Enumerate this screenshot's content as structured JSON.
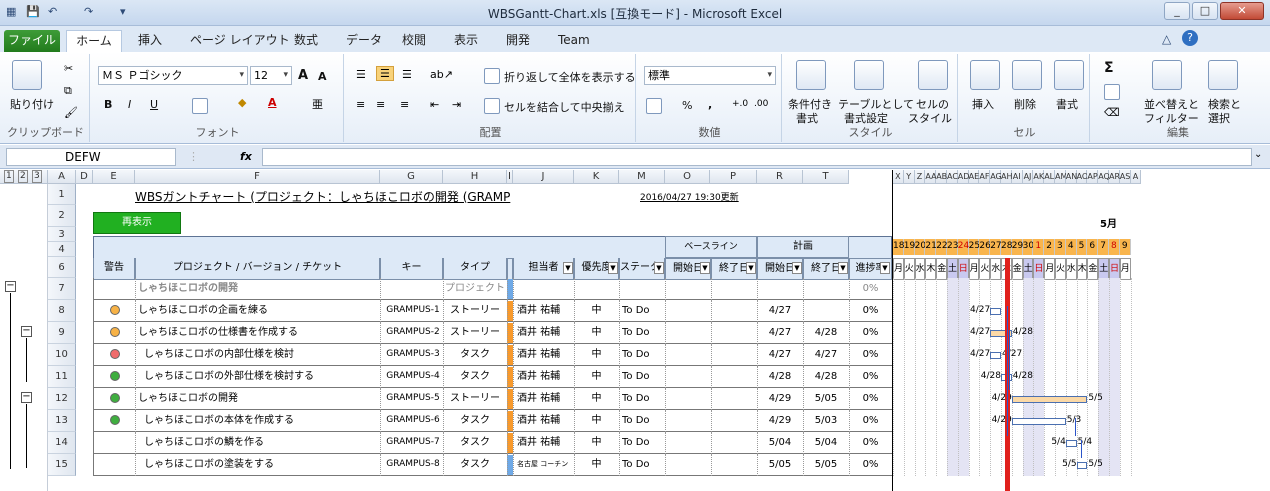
{
  "window": {
    "title": "WBSGantt-Chart.xls [互換モード] - Microsoft Excel",
    "controls": {
      "min": "_",
      "max": "□",
      "close": "✕"
    }
  },
  "tabs": [
    "ファイル",
    "ホーム",
    "挿入",
    "ページ レイアウト",
    "数式",
    "データ",
    "校閲",
    "表示",
    "開発",
    "Team"
  ],
  "ribbon": {
    "clipboard": {
      "paste": "貼り付け",
      "label": "クリップボード"
    },
    "font": {
      "name": "ＭＳ Ｐゴシック",
      "size": "12",
      "label": "フォント",
      "bold": "B",
      "italic": "I",
      "underline": "U",
      "grow": "A",
      "shrink": "A"
    },
    "align": {
      "wrap": "折り返して全体を表示する",
      "merge": "セルを結合して中央揃え",
      "label": "配置"
    },
    "number": {
      "format": "標準",
      "percent": "%",
      "comma": ",",
      "label": "数値"
    },
    "styles": {
      "cond": "条件付き\n書式",
      "table": "テーブルとして\n書式設定",
      "cell": "セルの\nスタイル",
      "label": "スタイル",
      "cond1": "条件付き",
      "cond2": "書式",
      "table1": "テーブルとして",
      "table2": "書式設定",
      "cell1": "セルの",
      "cell2": "スタイル"
    },
    "cells": {
      "insert": "挿入",
      "delete": "削除",
      "format": "書式",
      "label": "セル"
    },
    "edit": {
      "sigma": "Σ",
      "sort1": "並べ替えと",
      "sort2": "フィルター",
      "find1": "検索と",
      "find2": "選択",
      "label": "編集"
    }
  },
  "formula": {
    "name_box": "DEFW",
    "fx": "fx",
    "value": ""
  },
  "outline_levels": [
    "1",
    "2",
    "3"
  ],
  "columns": [
    "A",
    "D",
    "E",
    "F",
    "G",
    "H",
    "I",
    "J",
    "K",
    "M",
    "O",
    "P",
    "R",
    "T",
    "X",
    "Y",
    "Z",
    "AA",
    "AB",
    "AC",
    "AD",
    "AE",
    "AF",
    "AG",
    "AH",
    "AI",
    "AJ",
    "AK",
    "AL",
    "AM",
    "AN",
    "AO",
    "AP",
    "AQ",
    "AR",
    "AS",
    "A"
  ],
  "sheet": {
    "title": "WBSガントチャート (プロジェクト：しゃちほこロボの開発 (GRAMP",
    "updated": "2016/04/27 19:30更新",
    "redisplay": "再表示",
    "month": "5月",
    "headers": {
      "warning": "警告",
      "project": "プロジェクト / バージョン / チケット",
      "key": "キー",
      "type": "タイプ",
      "assignee": "担当者",
      "priority": "優先度",
      "status": "ステータス",
      "baseline": "ベースライン",
      "base_start": "開始日",
      "base_end": "終了日",
      "plan": "計画",
      "plan_start": "開始日",
      "plan_end": "終了日",
      "progress": "進捗率"
    },
    "row_numbers": [
      "1",
      "2",
      "3",
      "4",
      "6",
      "7",
      "8",
      "9",
      "10",
      "11",
      "12",
      "13",
      "14",
      "15"
    ],
    "days": [
      "18",
      "19",
      "20",
      "21",
      "22",
      "23",
      "24",
      "25",
      "26",
      "27",
      "28",
      "29",
      "30",
      "1",
      "2",
      "3",
      "4",
      "5",
      "6",
      "7",
      "8",
      "9"
    ],
    "weekdays": [
      "月",
      "火",
      "水",
      "木",
      "金",
      "土",
      "日",
      "月",
      "火",
      "水",
      "木",
      "金",
      "土",
      "日",
      "月",
      "火",
      "水",
      "木",
      "金",
      "土",
      "日",
      "月"
    ],
    "rows": [
      {
        "warn": "",
        "name": "しゃちほこロボの開発",
        "key": "",
        "type": "プロジェクト",
        "assignee": "",
        "priority": "",
        "status": "",
        "ps": "",
        "pe": "",
        "prog": "0%",
        "gl": "",
        "gr": ""
      },
      {
        "warn": "orange",
        "name": "しゃちほこロボの企画を練る",
        "key": "GRAMPUS-1",
        "type": "ストーリー",
        "assignee": "酒井 祐輔",
        "priority": "中",
        "status": "To Do",
        "ps": "4/27",
        "pe": "",
        "prog": "0%",
        "gl": "4/27",
        "gr": ""
      },
      {
        "warn": "orange",
        "name": "しゃちほこロボの仕様書を作成する",
        "key": "GRAMPUS-2",
        "type": "ストーリー",
        "assignee": "酒井 祐輔",
        "priority": "中",
        "status": "To Do",
        "ps": "4/27",
        "pe": "4/28",
        "prog": "0%",
        "gl": "4/27",
        "gr": "4/28"
      },
      {
        "warn": "red",
        "name": "しゃちほこロボの内部仕様を検討",
        "key": "GRAMPUS-3",
        "type": "タスク",
        "assignee": "酒井 祐輔",
        "priority": "中",
        "status": "To Do",
        "ps": "4/27",
        "pe": "4/27",
        "prog": "0%",
        "gl": "4/27",
        "gr": "4/27"
      },
      {
        "warn": "green",
        "name": "しゃちほこロボの外部仕様を検討する",
        "key": "GRAMPUS-4",
        "type": "タスク",
        "assignee": "酒井 祐輔",
        "priority": "中",
        "status": "To Do",
        "ps": "4/28",
        "pe": "4/28",
        "prog": "0%",
        "gl": "4/28",
        "gr": "4/28"
      },
      {
        "warn": "green",
        "name": "しゃちほこロボの開発",
        "key": "GRAMPUS-5",
        "type": "ストーリー",
        "assignee": "酒井 祐輔",
        "priority": "中",
        "status": "To Do",
        "ps": "4/29",
        "pe": "5/05",
        "prog": "0%",
        "gl": "4/29",
        "gr": "5/5"
      },
      {
        "warn": "green",
        "name": "しゃちほこロボの本体を作成する",
        "key": "GRAMPUS-6",
        "type": "タスク",
        "assignee": "酒井 祐輔",
        "priority": "中",
        "status": "To Do",
        "ps": "4/29",
        "pe": "5/03",
        "prog": "0%",
        "gl": "4/29",
        "gr": "5/3"
      },
      {
        "warn": "",
        "name": "しゃちほこロボの鱗を作る",
        "key": "GRAMPUS-7",
        "type": "タスク",
        "assignee": "酒井 祐輔",
        "priority": "中",
        "status": "To Do",
        "ps": "5/04",
        "pe": "5/04",
        "prog": "0%",
        "gl": "5/4",
        "gr": "5/4"
      },
      {
        "warn": "",
        "name": "しゃちほこロボの塗装をする",
        "key": "GRAMPUS-8",
        "type": "タスク",
        "assignee": "名古屋 コーチン",
        "priority": "中",
        "status": "To Do",
        "ps": "5/05",
        "pe": "5/05",
        "prog": "0%",
        "gl": "5/5",
        "gr": "5/5"
      }
    ]
  },
  "colors": {
    "file_tab": "#2d8a26",
    "weekend": "#e4e4f4",
    "orange_hdr": "#f9b54d",
    "today": "#e0201c",
    "bar_fill": "#fbd9a7"
  }
}
